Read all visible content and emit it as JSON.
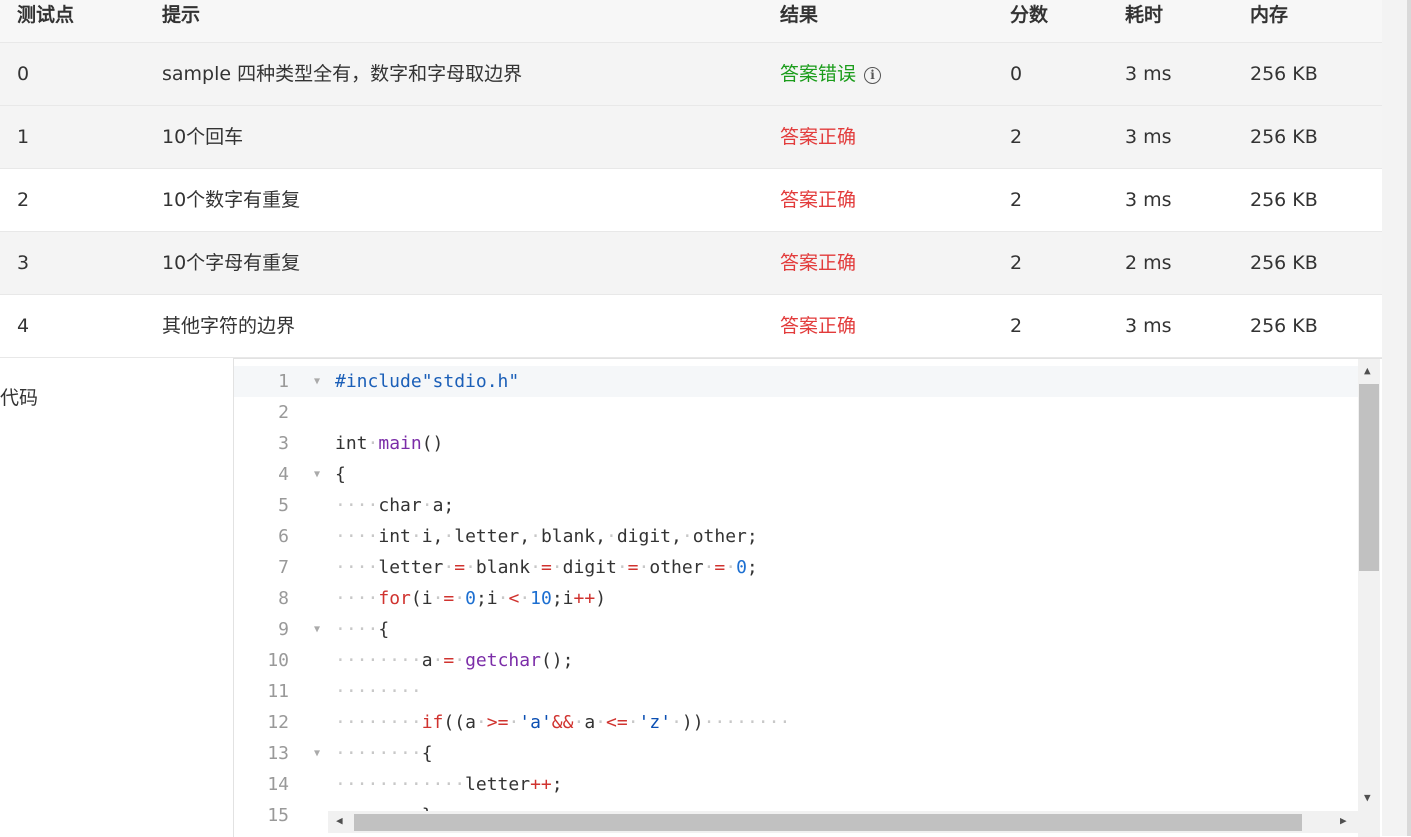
{
  "table": {
    "headers": [
      "测试点",
      "提示",
      "结果",
      "分数",
      "耗时",
      "内存"
    ],
    "rows": [
      {
        "id": "0",
        "hint": "sample 四种类型全有，数字和字母取边界",
        "result": "答案错误",
        "status": "wrong",
        "score": "0",
        "time": "3 ms",
        "memory": "256 KB"
      },
      {
        "id": "1",
        "hint": "10个回车",
        "result": "答案正确",
        "status": "right",
        "score": "2",
        "time": "3 ms",
        "memory": "256 KB"
      },
      {
        "id": "2",
        "hint": "10个数字有重复",
        "result": "答案正确",
        "status": "right",
        "score": "2",
        "time": "3 ms",
        "memory": "256 KB"
      },
      {
        "id": "3",
        "hint": "10个字母有重复",
        "result": "答案正确",
        "status": "right",
        "score": "2",
        "time": "2 ms",
        "memory": "256 KB"
      },
      {
        "id": "4",
        "hint": "其他字符的边界",
        "result": "答案正确",
        "status": "right",
        "score": "2",
        "time": "3 ms",
        "memory": "256 KB"
      }
    ],
    "info_icon": "info-icon",
    "colors": {
      "wrong": "#1a9c1a",
      "right": "#e23b3b"
    }
  },
  "code_section": {
    "label": "代码",
    "line_numbers": [
      "1",
      "2",
      "3",
      "4",
      "5",
      "6",
      "7",
      "8",
      "9",
      "10",
      "11",
      "12",
      "13",
      "14",
      "15"
    ],
    "lines": [
      "#include\"stdio.h\"",
      "",
      "int main()",
      "{",
      "    char a;",
      "    int i, letter, blank, digit, other;",
      "    letter = blank = digit = other = 0;",
      "    for(i = 0;i < 10;i++)",
      "    {",
      "        a = getchar();",
      "        ",
      "        if((a >= 'a'&& a <= 'z' ))        ",
      "        {",
      "            letter++;",
      "        }"
    ],
    "foldable_lines": [
      1,
      4,
      9,
      13
    ]
  }
}
